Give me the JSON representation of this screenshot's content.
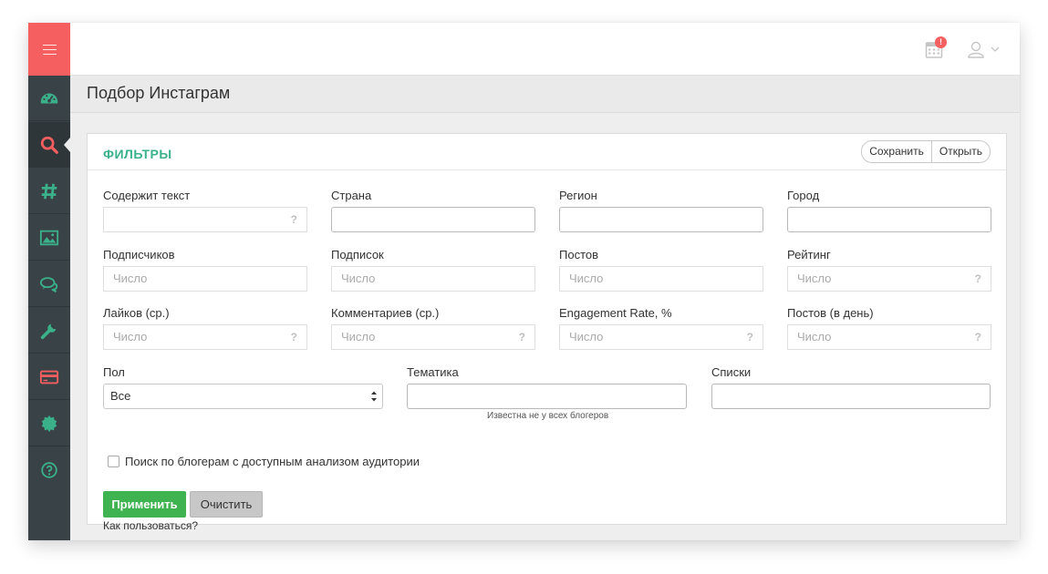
{
  "header": {
    "page_title": "Подбор Инстаграм",
    "notification_badge": "!"
  },
  "sidebar": {
    "items": [
      {
        "icon": "dashboard-icon",
        "color": "#3bb18a"
      },
      {
        "icon": "search-icon",
        "color": "#f65f5f",
        "active": true
      },
      {
        "icon": "hashtag-icon",
        "color": "#3bb18a"
      },
      {
        "icon": "image-icon",
        "color": "#3bb18a"
      },
      {
        "icon": "chat-icon",
        "color": "#3bb18a"
      },
      {
        "icon": "wrench-icon",
        "color": "#3bb18a"
      },
      {
        "icon": "credit-card-icon",
        "color": "#f65f5f"
      },
      {
        "icon": "badge-icon",
        "color": "#3bb18a"
      },
      {
        "icon": "help-icon",
        "color": "#3bb18a"
      }
    ]
  },
  "filters": {
    "title": "ФИЛЬТРЫ",
    "save_label": "Сохранить",
    "open_label": "Открыть",
    "row1": {
      "text_label": "Содержит текст",
      "text_value": "",
      "country_label": "Страна",
      "region_label": "Регион",
      "city_label": "Город"
    },
    "row2": {
      "subscribers_label": "Подписчиков",
      "subscriptions_label": "Подписок",
      "posts_label": "Постов",
      "rating_label": "Рейтинг"
    },
    "row3": {
      "likes_label": "Лайков (ср.)",
      "comments_label": "Комментариев (ср.)",
      "er_label": "Engagement Rate, %",
      "posts_per_day_label": "Постов (в день)"
    },
    "number_placeholder": "Число",
    "help_mark": "?",
    "gender_label": "Пол",
    "gender_value": "Все",
    "topic_label": "Тематика",
    "topic_hint": "Известна не у всех блогеров",
    "lists_label": "Списки",
    "audience_checkbox_label": "Поиск по блогерам с доступным анализом аудитории",
    "apply_label": "Применить",
    "clear_label": "Очистить",
    "howto_label": "Как пользоваться?"
  },
  "colors": {
    "accent_red": "#f65f5f",
    "accent_green": "#3bb18a",
    "apply_green": "#3fb34f",
    "sidebar_bg": "#394246"
  }
}
